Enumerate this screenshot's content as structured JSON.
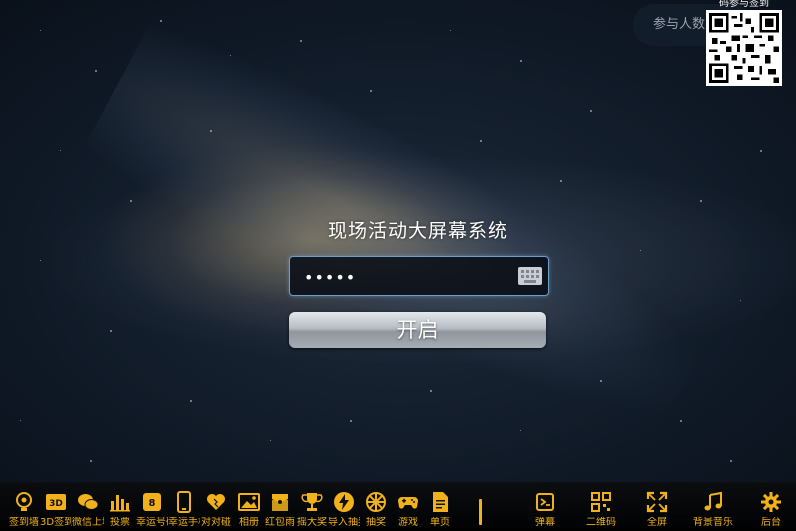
{
  "top": {
    "count_label": "参与人数",
    "qr_caption": "码参与签到"
  },
  "login": {
    "title": "现场活动大屏幕系统",
    "password_value": "•••••",
    "start_label": "开启"
  },
  "toolbar": {
    "items": [
      {
        "label": "签到墙",
        "icon": "signin-icon"
      },
      {
        "label": "3D签到",
        "icon": "3d-icon"
      },
      {
        "label": "微信上墙",
        "icon": "wechat-icon"
      },
      {
        "label": "投票",
        "icon": "bar-chart-icon"
      },
      {
        "label": "幸运号码",
        "icon": "lucky-number-icon"
      },
      {
        "label": "幸运手机",
        "icon": "phone-icon"
      },
      {
        "label": "对对碰",
        "icon": "hearts-icon"
      },
      {
        "label": "相册",
        "icon": "photo-icon"
      },
      {
        "label": "红包雨",
        "icon": "red-packet-icon"
      },
      {
        "label": "摇大奖",
        "icon": "trophy-icon"
      },
      {
        "label": "导入抽奖",
        "icon": "lightning-icon"
      },
      {
        "label": "抽奖",
        "icon": "wheel-icon"
      },
      {
        "label": "游戏",
        "icon": "gamepad-icon"
      },
      {
        "label": "单页",
        "icon": "page-icon"
      }
    ],
    "right_items": [
      {
        "label": "弹幕",
        "icon": "danmaku-icon"
      },
      {
        "label": "二维码",
        "icon": "qrcode-icon"
      },
      {
        "label": "全屏",
        "icon": "fullscreen-icon"
      },
      {
        "label": "背景音乐",
        "icon": "music-icon"
      },
      {
        "label": "后台",
        "icon": "gear-icon"
      }
    ]
  },
  "colors": {
    "accent": "#f1b11b",
    "input_border": "#6f9ec7"
  }
}
